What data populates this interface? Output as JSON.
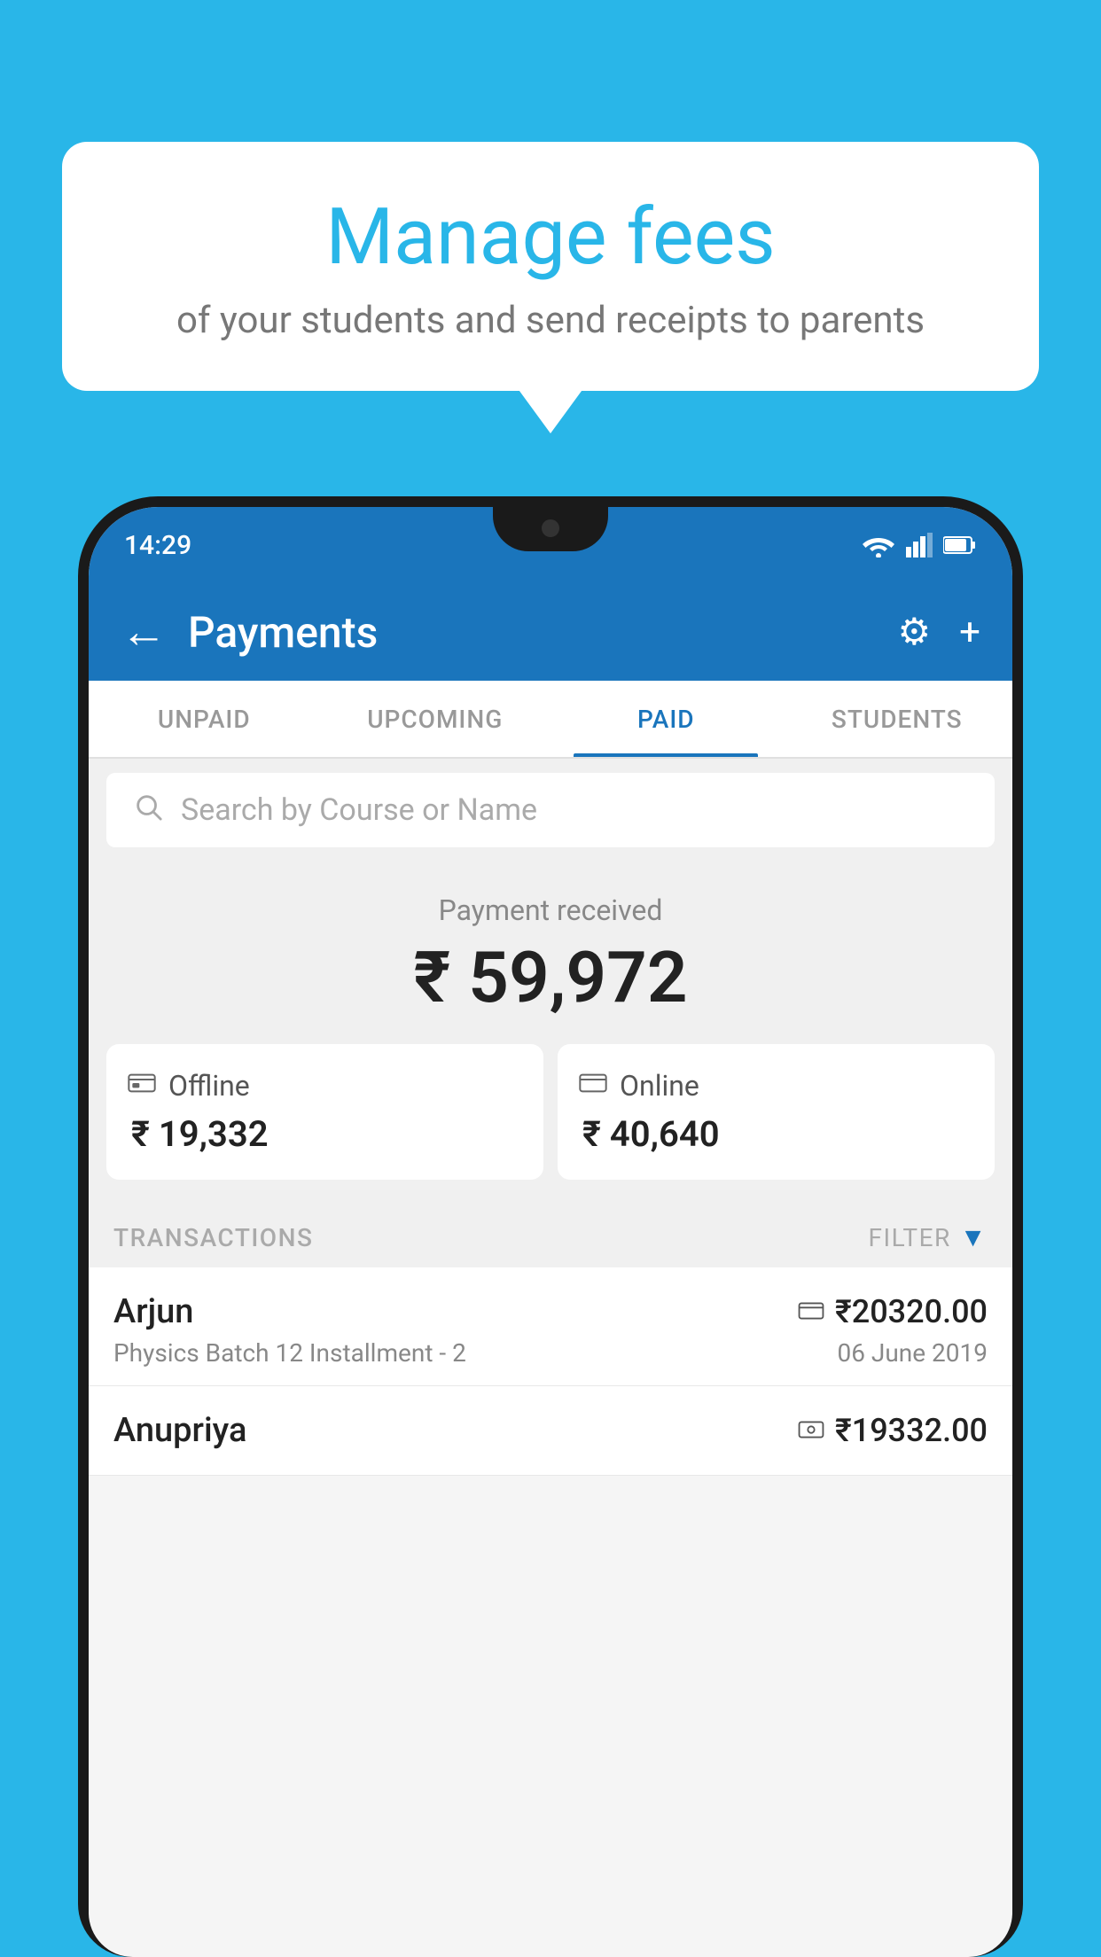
{
  "background_color": "#29b6e8",
  "speech_bubble": {
    "title": "Manage fees",
    "subtitle": "of your students and send receipts to parents"
  },
  "status_bar": {
    "time": "14:29"
  },
  "app_bar": {
    "title": "Payments",
    "back_icon": "←",
    "settings_icon": "⚙",
    "add_icon": "+"
  },
  "tabs": [
    {
      "label": "UNPAID",
      "active": false
    },
    {
      "label": "UPCOMING",
      "active": false
    },
    {
      "label": "PAID",
      "active": true
    },
    {
      "label": "STUDENTS",
      "active": false
    }
  ],
  "search": {
    "placeholder": "Search by Course or Name"
  },
  "payment_summary": {
    "label": "Payment received",
    "amount": "₹ 59,972",
    "offline": {
      "label": "Offline",
      "amount": "₹ 19,332"
    },
    "online": {
      "label": "Online",
      "amount": "₹ 40,640"
    }
  },
  "transactions": {
    "header": "TRANSACTIONS",
    "filter_label": "FILTER",
    "items": [
      {
        "name": "Arjun",
        "course": "Physics Batch 12 Installment - 2",
        "amount": "₹20320.00",
        "date": "06 June 2019",
        "payment_mode": "card"
      },
      {
        "name": "Anupriya",
        "course": "",
        "amount": "₹19332.00",
        "date": "",
        "payment_mode": "cash"
      }
    ]
  }
}
